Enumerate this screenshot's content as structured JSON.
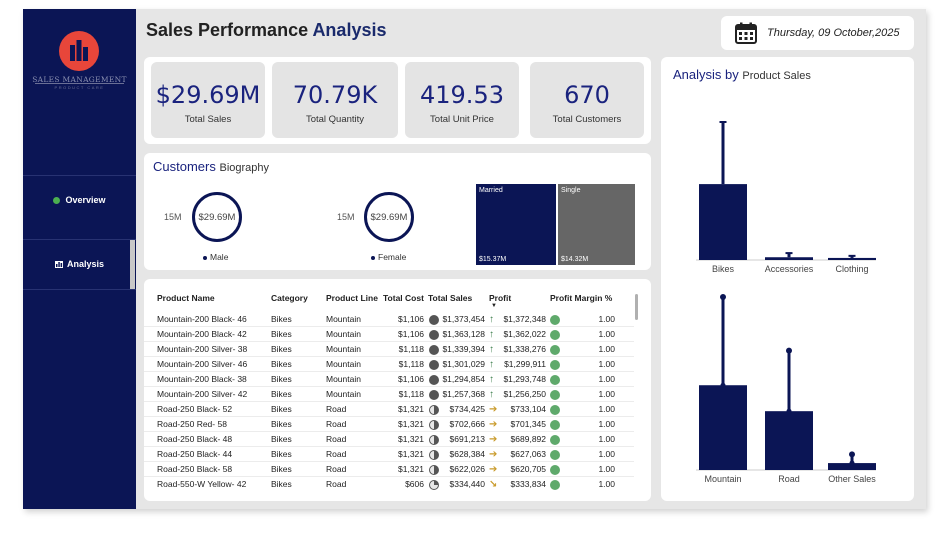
{
  "header": {
    "title_part1": "Sales Performance",
    "title_part2": "Analysis",
    "date": "Thursday, 09 October,2025",
    "calendar_icon": "calendar-icon"
  },
  "sidebar": {
    "brand": "SALES MANAGEMENT",
    "brand_sub": "PRODUCT CARE",
    "items": [
      {
        "label": "Overview",
        "icon": "status-dot-icon"
      },
      {
        "label": "Analysis",
        "icon": "bar-chart-icon"
      }
    ]
  },
  "kpis": [
    {
      "value": "$29.69M",
      "label": "Total Sales"
    },
    {
      "value": "70.79K",
      "label": "Total Quantity"
    },
    {
      "value": "419.53",
      "label": "Total Unit Price"
    },
    {
      "value": "670",
      "label": "Total Customers"
    }
  ],
  "biography": {
    "title": "Customers",
    "title_small": "Biography",
    "gauges": [
      {
        "min_label": "15M",
        "value": "$29.69M",
        "legend": "Male"
      },
      {
        "min_label": "15M",
        "value": "$29.69M",
        "legend": "Female"
      }
    ],
    "treemap": [
      {
        "label": "Married",
        "value": "$15.37M",
        "color": "#0b1555"
      },
      {
        "label": "Single",
        "value": "$14.32M",
        "color": "#666666"
      }
    ]
  },
  "table": {
    "columns": [
      "Product Name",
      "Category",
      "Product Line",
      "Total Cost",
      "Total Sales",
      "Profit",
      "Profit Margin %"
    ],
    "rows": [
      {
        "name": "Mountain-200 Black- 46",
        "category": "Bikes",
        "line": "Mountain",
        "cost": "$1,106",
        "sales": "$1,373,454",
        "profit": "$1,372,348",
        "margin": "1.00",
        "trend": "up"
      },
      {
        "name": "Mountain-200 Black- 42",
        "category": "Bikes",
        "line": "Mountain",
        "cost": "$1,106",
        "sales": "$1,363,128",
        "profit": "$1,362,022",
        "margin": "1.00",
        "trend": "up"
      },
      {
        "name": "Mountain-200 Silver- 38",
        "category": "Bikes",
        "line": "Mountain",
        "cost": "$1,118",
        "sales": "$1,339,394",
        "profit": "$1,338,276",
        "margin": "1.00",
        "trend": "up"
      },
      {
        "name": "Mountain-200 Silver- 46",
        "category": "Bikes",
        "line": "Mountain",
        "cost": "$1,118",
        "sales": "$1,301,029",
        "profit": "$1,299,911",
        "margin": "1.00",
        "trend": "up"
      },
      {
        "name": "Mountain-200 Black- 38",
        "category": "Bikes",
        "line": "Mountain",
        "cost": "$1,106",
        "sales": "$1,294,854",
        "profit": "$1,293,748",
        "margin": "1.00",
        "trend": "up"
      },
      {
        "name": "Mountain-200 Silver- 42",
        "category": "Bikes",
        "line": "Mountain",
        "cost": "$1,118",
        "sales": "$1,257,368",
        "profit": "$1,256,250",
        "margin": "1.00",
        "trend": "up"
      },
      {
        "name": "Road-250 Black- 52",
        "category": "Bikes",
        "line": "Road",
        "cost": "$1,321",
        "sales": "$734,425",
        "profit": "$733,104",
        "margin": "1.00",
        "trend": "right"
      },
      {
        "name": "Road-250 Red- 58",
        "category": "Bikes",
        "line": "Road",
        "cost": "$1,321",
        "sales": "$702,666",
        "profit": "$701,345",
        "margin": "1.00",
        "trend": "right"
      },
      {
        "name": "Road-250 Black- 48",
        "category": "Bikes",
        "line": "Road",
        "cost": "$1,321",
        "sales": "$691,213",
        "profit": "$689,892",
        "margin": "1.00",
        "trend": "right"
      },
      {
        "name": "Road-250 Black- 44",
        "category": "Bikes",
        "line": "Road",
        "cost": "$1,321",
        "sales": "$628,384",
        "profit": "$627,063",
        "margin": "1.00",
        "trend": "right"
      },
      {
        "name": "Road-250 Black- 58",
        "category": "Bikes",
        "line": "Road",
        "cost": "$1,321",
        "sales": "$622,026",
        "profit": "$620,705",
        "margin": "1.00",
        "trend": "right"
      },
      {
        "name": "Road-550-W Yellow- 42",
        "category": "Bikes",
        "line": "Road",
        "cost": "$606",
        "sales": "$334,440",
        "profit": "$333,834",
        "margin": "1.00",
        "trend": "down-right"
      }
    ]
  },
  "analysis": {
    "title": "Analysis by",
    "title_small": "Product Sales"
  },
  "chart_data": [
    {
      "type": "bar",
      "categories": [
        "Bikes",
        "Accessories",
        "Clothing"
      ],
      "values": [
        0.55,
        0.02,
        0.015
      ],
      "whisker_top": [
        1.0,
        0.05,
        0.03
      ],
      "ylim": [
        0,
        1
      ],
      "color": "#0b1555"
    },
    {
      "type": "bar",
      "categories": [
        "Mountain",
        "Road",
        "Other Sales"
      ],
      "values": [
        0.49,
        0.34,
        0.04
      ],
      "whisker_top": [
        1.0,
        0.69,
        0.09
      ],
      "ylim": [
        0,
        1
      ],
      "color": "#0b1555"
    }
  ]
}
